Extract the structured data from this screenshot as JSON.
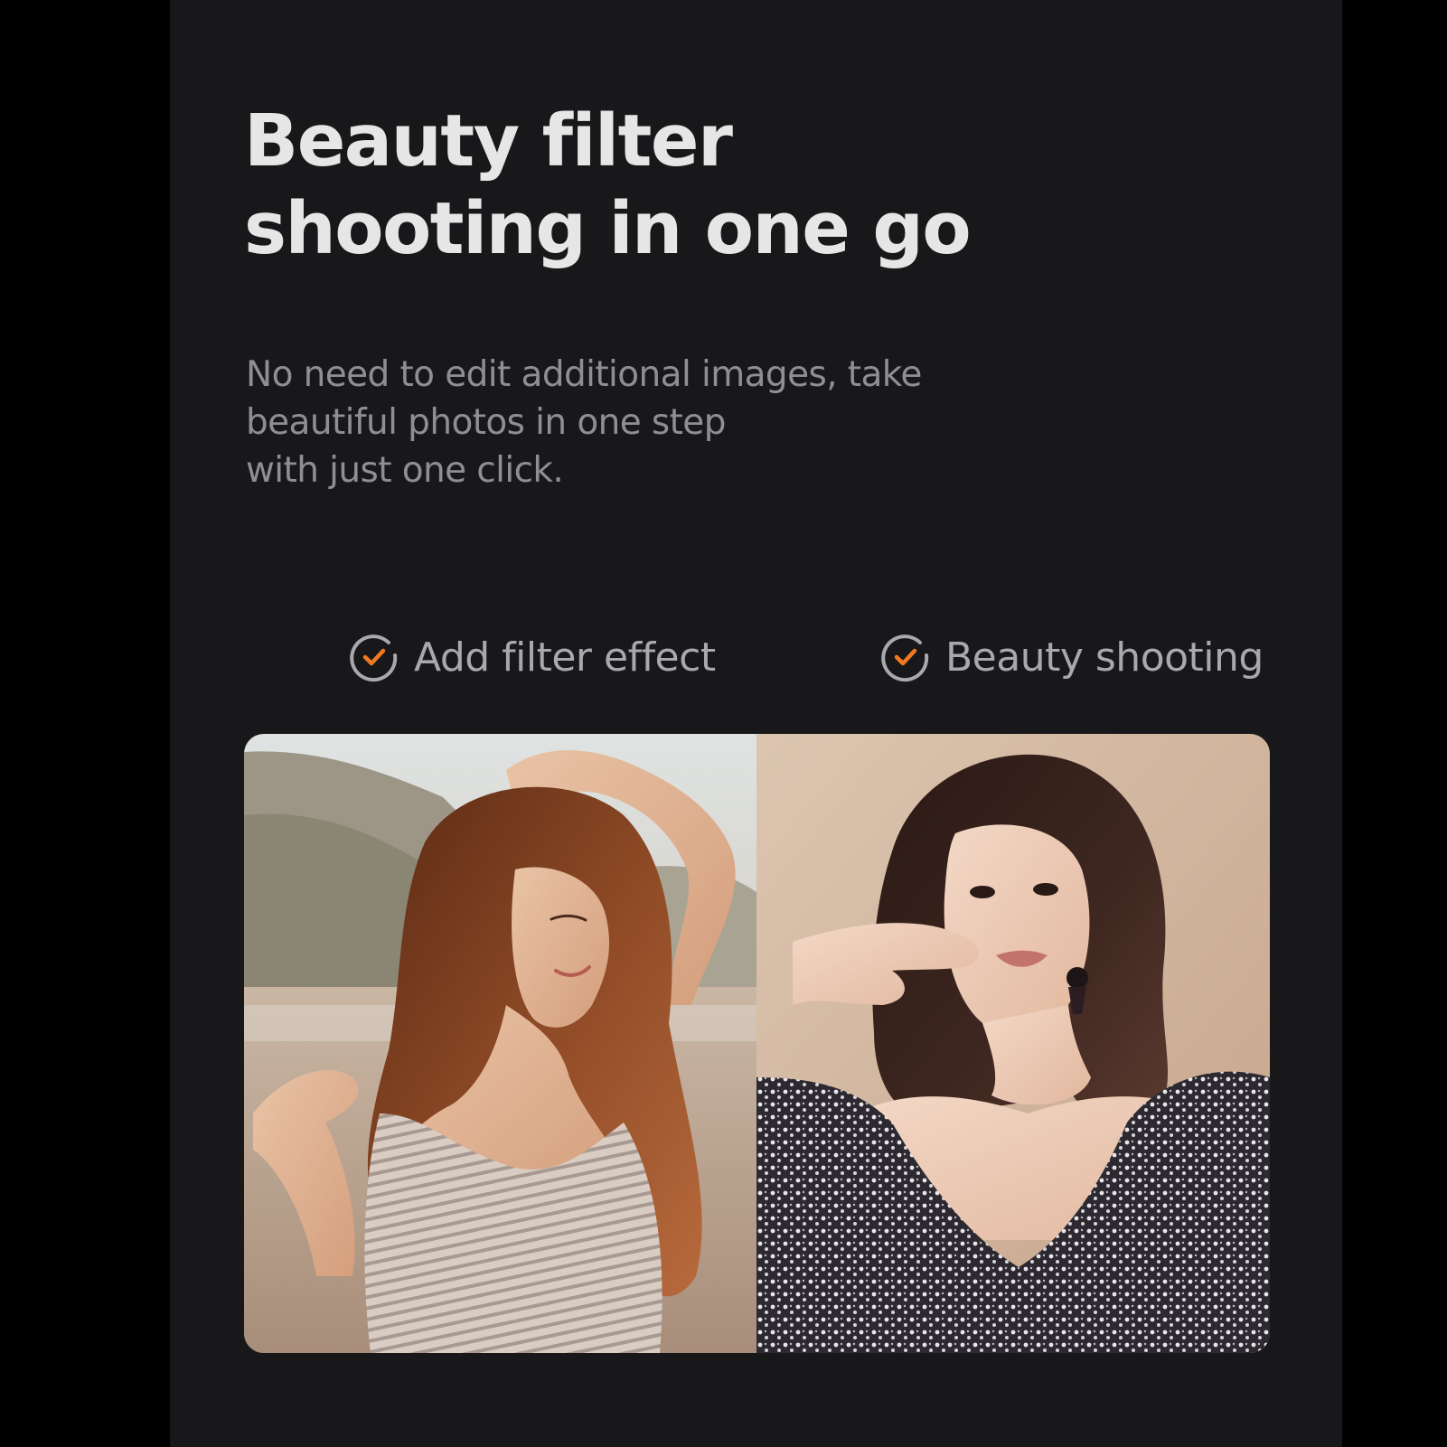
{
  "headline": {
    "line1": "Beauty filter",
    "line2": "shooting in one go"
  },
  "description": {
    "line1": "No need to edit additional images, take",
    "line2": "beautiful photos in one step",
    "line3": "with just one click."
  },
  "features": [
    {
      "label": "Add filter effect",
      "icon": "check-circle-icon"
    },
    {
      "label": "Beauty shooting",
      "icon": "check-circle-icon"
    }
  ],
  "colors": {
    "page_background": "#000000",
    "panel_background": "#18181a",
    "headline": "#e6e6e6",
    "description": "#8f8f93",
    "feature_label": "#a9a9ad",
    "check_accent": "#f07820"
  },
  "photos": [
    {
      "name": "filter-effect-photo"
    },
    {
      "name": "beauty-shooting-photo"
    }
  ]
}
